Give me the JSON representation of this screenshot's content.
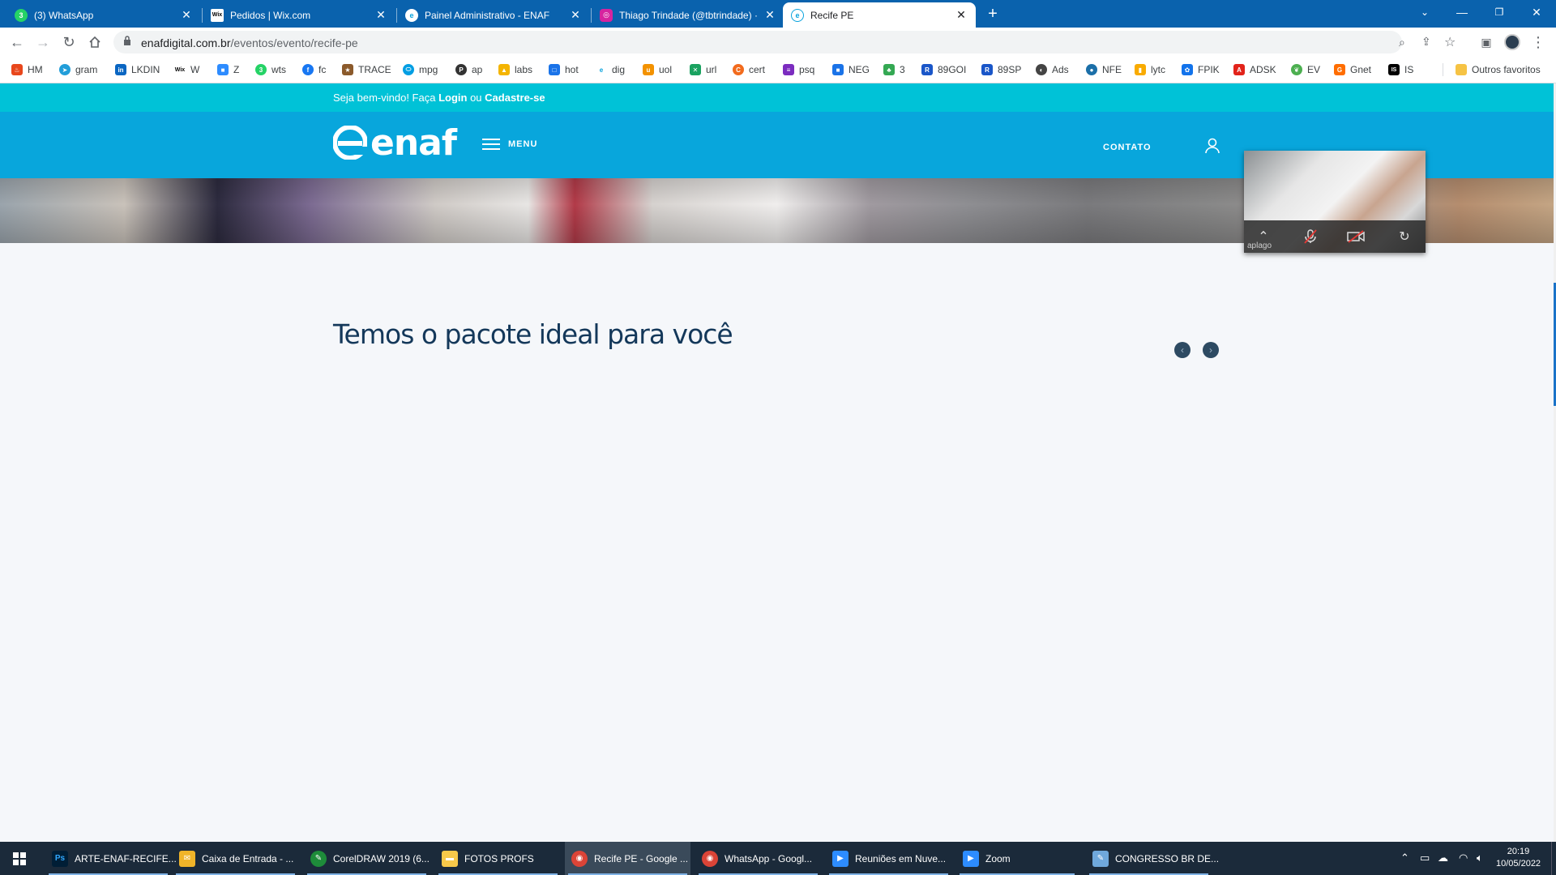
{
  "browser": {
    "tabs": [
      {
        "title": "(3) WhatsApp",
        "icon": "whatsapp-icon",
        "color": "#25d366",
        "glyph": "3"
      },
      {
        "title": "Pedidos | Wix.com",
        "icon": "wix-icon",
        "color": "#000000",
        "glyph": "Wix"
      },
      {
        "title": "Painel Administrativo - ENAF",
        "icon": "enaf-icon",
        "color": "#0aa3dd",
        "glyph": "e"
      },
      {
        "title": "Thiago Trindade (@tbtrindade) ·",
        "icon": "instagram-icon",
        "color": "#d6249f",
        "glyph": "◎"
      },
      {
        "title": "Recife PE",
        "icon": "enaf-icon",
        "color": "#0aa3dd",
        "glyph": "e"
      }
    ],
    "url_domain": "enafdigital.com.br",
    "url_path": "/eventos/evento/recife-pe"
  },
  "bookmarks": [
    {
      "label": "HM",
      "color": "#e8471c",
      "glyph": "♨"
    },
    {
      "label": "gram",
      "color": "#229ed9",
      "glyph": "➤"
    },
    {
      "label": "LKDIN",
      "color": "#0a66c2",
      "glyph": "in"
    },
    {
      "label": "W",
      "color": "#000000",
      "glyph": "Wix"
    },
    {
      "label": "Z",
      "color": "#2d8cff",
      "glyph": "■"
    },
    {
      "label": "wts",
      "color": "#25d366",
      "glyph": "3"
    },
    {
      "label": "fc",
      "color": "#1877f2",
      "glyph": "f"
    },
    {
      "label": "TRACE",
      "color": "#8b5a2b",
      "glyph": "★"
    },
    {
      "label": "mpg",
      "color": "#009ee3",
      "glyph": "⬭"
    },
    {
      "label": "ap",
      "color": "#333333",
      "glyph": "P"
    },
    {
      "label": "labs",
      "color": "#f4b400",
      "glyph": "▲"
    },
    {
      "label": "hot",
      "color": "#1a73e8",
      "glyph": "□"
    },
    {
      "label": "dig",
      "color": "#0aa3dd",
      "glyph": "e"
    },
    {
      "label": "uol",
      "color": "#f39200",
      "glyph": "u"
    },
    {
      "label": "url",
      "color": "#1aa260",
      "glyph": "✕"
    },
    {
      "label": "cert",
      "color": "#f26b1d",
      "glyph": "C"
    },
    {
      "label": "psq",
      "color": "#7b2cbf",
      "glyph": "≡"
    },
    {
      "label": "NEG",
      "color": "#1a73e8",
      "glyph": "■"
    },
    {
      "label": "3",
      "color": "#34a853",
      "glyph": "♣"
    },
    {
      "label": "89GOI",
      "color": "#1a56c8",
      "glyph": "R"
    },
    {
      "label": "89SP",
      "color": "#1a56c8",
      "glyph": "R"
    },
    {
      "label": "Ads",
      "color": "#444444",
      "glyph": "◐"
    },
    {
      "label": "NFE",
      "color": "#1b6fa8",
      "glyph": "●"
    },
    {
      "label": "lytc",
      "color": "#f9ab00",
      "glyph": "▮"
    },
    {
      "label": "FPIK",
      "color": "#1273eb",
      "glyph": "✿"
    },
    {
      "label": "ADSK",
      "color": "#e2231a",
      "glyph": "A"
    },
    {
      "label": "EV",
      "color": "#4caf50",
      "glyph": "❦"
    },
    {
      "label": "Gnet",
      "color": "#ff6d00",
      "glyph": "G"
    },
    {
      "label": "IS",
      "color": "#000000",
      "glyph": "IS"
    }
  ],
  "bookmarks_other": "Outros favoritos",
  "site": {
    "welcome_prefix": "Seja bem-vindo! Faça ",
    "login": "Login",
    "or": " ou ",
    "signup": "Cadastre-se",
    "logo": "enaf",
    "menu_label": "MENU",
    "contact": "CONTATO",
    "section_title": "Temos o pacote ideal para você"
  },
  "video_call": {
    "participant": "aplago"
  },
  "taskbar": {
    "items": [
      {
        "label": "ARTE-ENAF-RECIFE...",
        "icon": "photoshop-icon",
        "color": "#001e36",
        "glyph": "Ps"
      },
      {
        "label": "Caixa de Entrada - ...",
        "icon": "mail-icon",
        "color": "#f0b429",
        "glyph": "✉"
      },
      {
        "label": "CorelDRAW 2019 (6...",
        "icon": "coreldraw-icon",
        "color": "#1e8c3a",
        "glyph": "✎"
      },
      {
        "label": "FOTOS PROFS",
        "icon": "folder-icon",
        "color": "#f8c94a",
        "glyph": "▬"
      },
      {
        "label": "Recife PE - Google ...",
        "icon": "chrome-icon",
        "color": "#db4437",
        "glyph": "◉"
      },
      {
        "label": "WhatsApp - Googl...",
        "icon": "chrome-icon",
        "color": "#db4437",
        "glyph": "◉"
      },
      {
        "label": "Reuniões em Nuve...",
        "icon": "zoom-icon",
        "color": "#2d8cff",
        "glyph": "▶"
      },
      {
        "label": "Zoom",
        "icon": "zoom-icon",
        "color": "#2d8cff",
        "glyph": "▶"
      },
      {
        "label": "CONGRESSO BR DE...",
        "icon": "notepad-icon",
        "color": "#6fa8dc",
        "glyph": "✎"
      }
    ],
    "time": "20:19",
    "date": "10/05/2022"
  }
}
